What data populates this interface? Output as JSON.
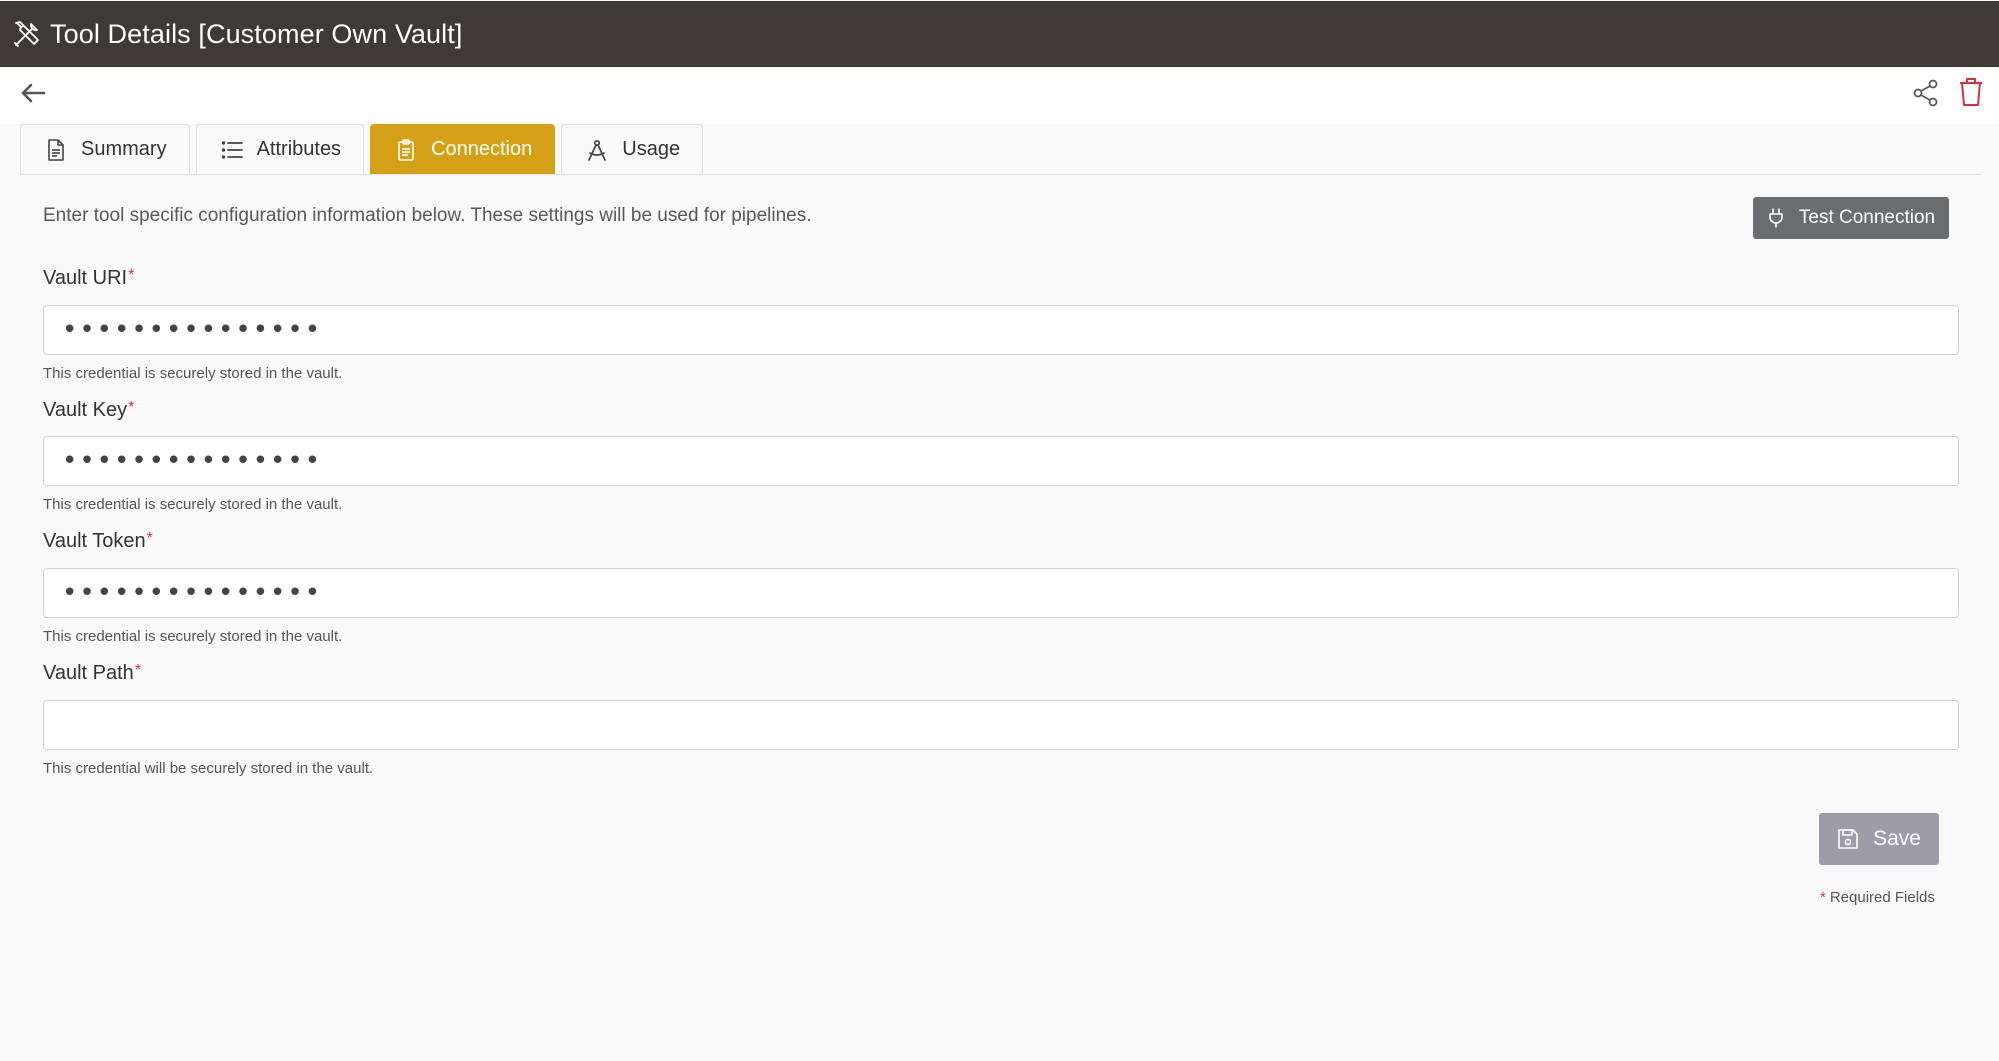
{
  "header": {
    "title": "Tool Details [Customer Own Vault]",
    "icon": "tools-icon"
  },
  "actions": {
    "back_icon": "arrow-left-icon",
    "share_icon": "share-icon",
    "delete_icon": "trash-icon",
    "delete_color": "#d9303a"
  },
  "tabs": [
    {
      "label": "Summary",
      "icon": "file-icon",
      "active": false
    },
    {
      "label": "Attributes",
      "icon": "list-icon",
      "active": false
    },
    {
      "label": "Connection",
      "icon": "clipboard-icon",
      "active": true
    },
    {
      "label": "Usage",
      "icon": "compass-icon",
      "active": false
    }
  ],
  "connection": {
    "intro": "Enter tool specific configuration information below. These settings will be used for pipelines.",
    "test_button": {
      "label": "Test Connection",
      "icon": "plug-icon"
    },
    "fields": [
      {
        "label": "Vault URI",
        "required_mark": "*",
        "value": "•••••••••••••••",
        "help": "This credential is securely stored in the vault."
      },
      {
        "label": "Vault Key",
        "required_mark": "*",
        "value": "•••••••••••••••",
        "help": "This credential is securely stored in the vault."
      },
      {
        "label": "Vault Token",
        "required_mark": "*",
        "value": "•••••••••••••••",
        "help": "This credential is securely stored in the vault."
      },
      {
        "label": "Vault Path",
        "required_mark": "*",
        "value": "",
        "help": "This credential will be securely stored in the vault."
      }
    ],
    "save_button": {
      "label": "Save",
      "icon": "save-icon"
    },
    "required_note": {
      "mark": "*",
      "text": "Required Fields"
    }
  },
  "colors": {
    "titlebar": "#3d3a37",
    "active_tab": "#d4a016",
    "test_button": "#6a6c70",
    "save_button": "#9d9ca8",
    "required": "#d9303a"
  }
}
